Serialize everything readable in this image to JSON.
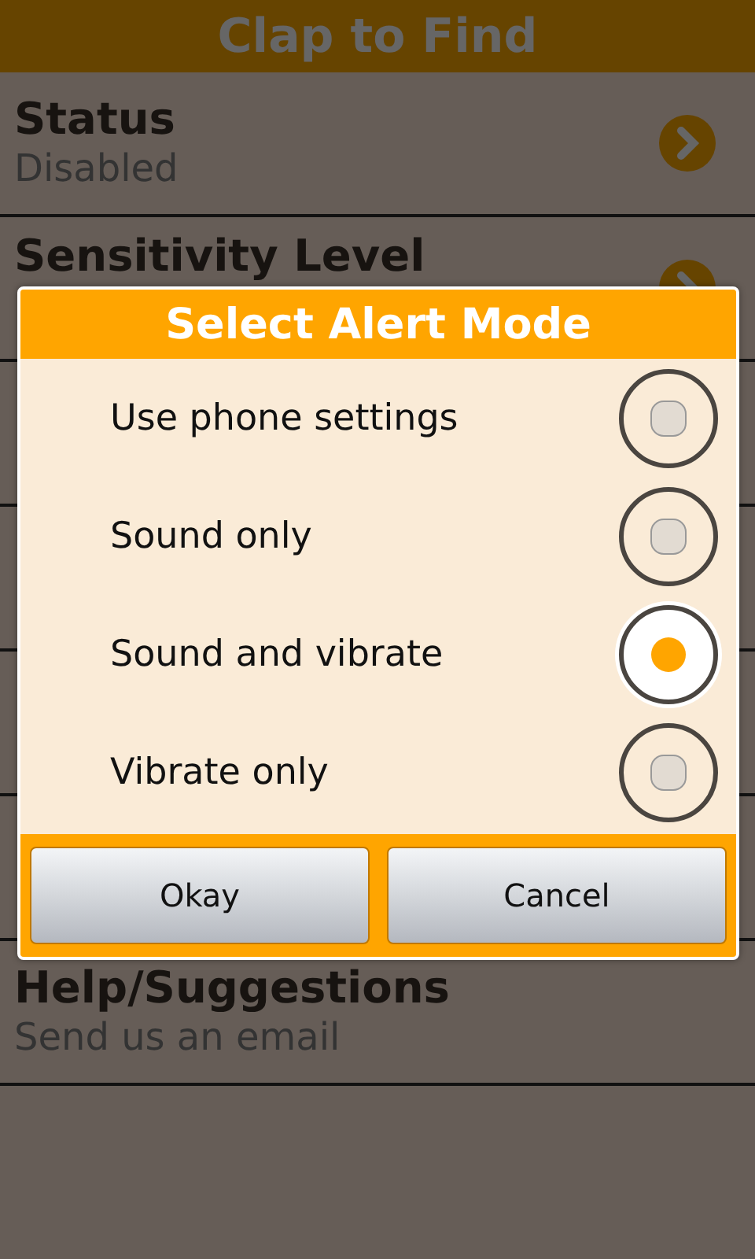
{
  "app_bar": {
    "title": "Clap to Find"
  },
  "settings": [
    {
      "title": "Status",
      "subtitle": "Disabled"
    },
    {
      "title": "Sensitivity Level"
    }
  ],
  "settings_bottom": [
    {
      "title": "Help/Suggestions",
      "subtitle": "Send us an email"
    }
  ],
  "dialog": {
    "title": "Select Alert Mode",
    "options": [
      {
        "label": "Use phone settings",
        "selected": false
      },
      {
        "label": "Sound only",
        "selected": false
      },
      {
        "label": "Sound and vibrate",
        "selected": true
      },
      {
        "label": "Vibrate only",
        "selected": false
      }
    ],
    "buttons": [
      "Okay",
      "Cancel"
    ]
  }
}
